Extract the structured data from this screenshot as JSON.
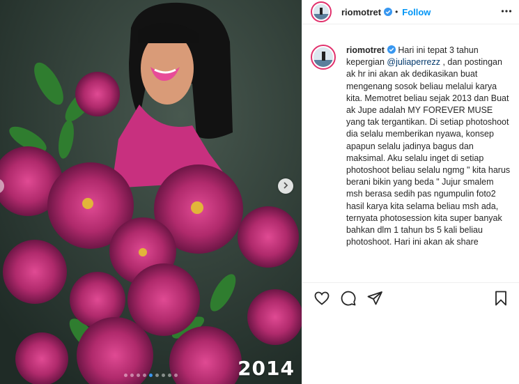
{
  "media": {
    "year_label": "2014",
    "slide_count": 9,
    "active_slide": 5
  },
  "header": {
    "username": "riomotret",
    "separator": "•",
    "follow_label": "Follow"
  },
  "caption": {
    "username": "riomotret",
    "text_before_mention": " Hari ini tepat 3 tahun kepergian ",
    "mention": "@juliaperrezz",
    "text_after_mention": " , dan postingan ak hr ini akan ak dedikasikan buat mengenang sosok beliau melalui karya kita. Memotret beliau sejak 2013 dan Buat ak Jupe adalah MY FOREVER MUSE yang tak tergantikan. Di setiap photoshoot dia selalu memberikan nyawa, konsep apapun selalu jadinya bagus dan maksimal. Aku selalu inget di setiap photoshoot beliau selalu ngmg \" kita harus berani bikin yang beda \" Jujur smalem msh berasa sedih pas ngumpulin foto2 hasil karya kita selama beliau msh ada, ternyata photosession kita super banyak bahkan dlm 1 tahun bs 5 kali beliau photoshoot. Hari ini akan ak share"
  },
  "icons": {
    "verified": "verified-badge-icon",
    "more": "more-options-icon",
    "like": "heart-icon",
    "comment": "comment-icon",
    "share": "paper-plane-icon",
    "save": "bookmark-icon",
    "next": "chevron-right-icon"
  },
  "colors": {
    "accent": "#0095f6",
    "mention": "#00376b",
    "verified": "#3897f0",
    "story_ring": "#e1306c",
    "photo_background": "#2f3f38",
    "flowers": "#c2307a"
  }
}
